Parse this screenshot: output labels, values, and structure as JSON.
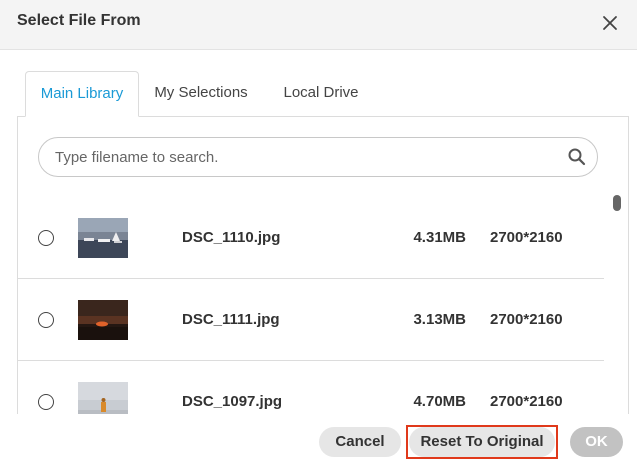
{
  "dialog": {
    "title": "Select File From",
    "close_icon": "close-icon"
  },
  "tabs": [
    {
      "label": "Main Library",
      "active": true
    },
    {
      "label": "My Selections",
      "active": false
    },
    {
      "label": "Local Drive",
      "active": false
    }
  ],
  "search": {
    "placeholder": "Type filename to search.",
    "value": "",
    "icon": "search-icon"
  },
  "files": [
    {
      "name": "DSC_1110.jpg",
      "size": "4.31MB",
      "dimensions": "2700*2160",
      "thumbnail": "boats-on-water-thumbnail"
    },
    {
      "name": "DSC_1111.jpg",
      "size": "3.13MB",
      "dimensions": "2700*2160",
      "thumbnail": "sunset-thumbnail"
    },
    {
      "name": "DSC_1097.jpg",
      "size": "4.70MB",
      "dimensions": "2700*2160",
      "thumbnail": "person-on-beach-thumbnail"
    }
  ],
  "footer": {
    "cancel_label": "Cancel",
    "reset_label": "Reset To Original",
    "ok_label": "OK"
  },
  "colors": {
    "accent": "#1a9ad6",
    "highlight": "#e0391b",
    "ok_disabled": "#c2c2c2"
  }
}
